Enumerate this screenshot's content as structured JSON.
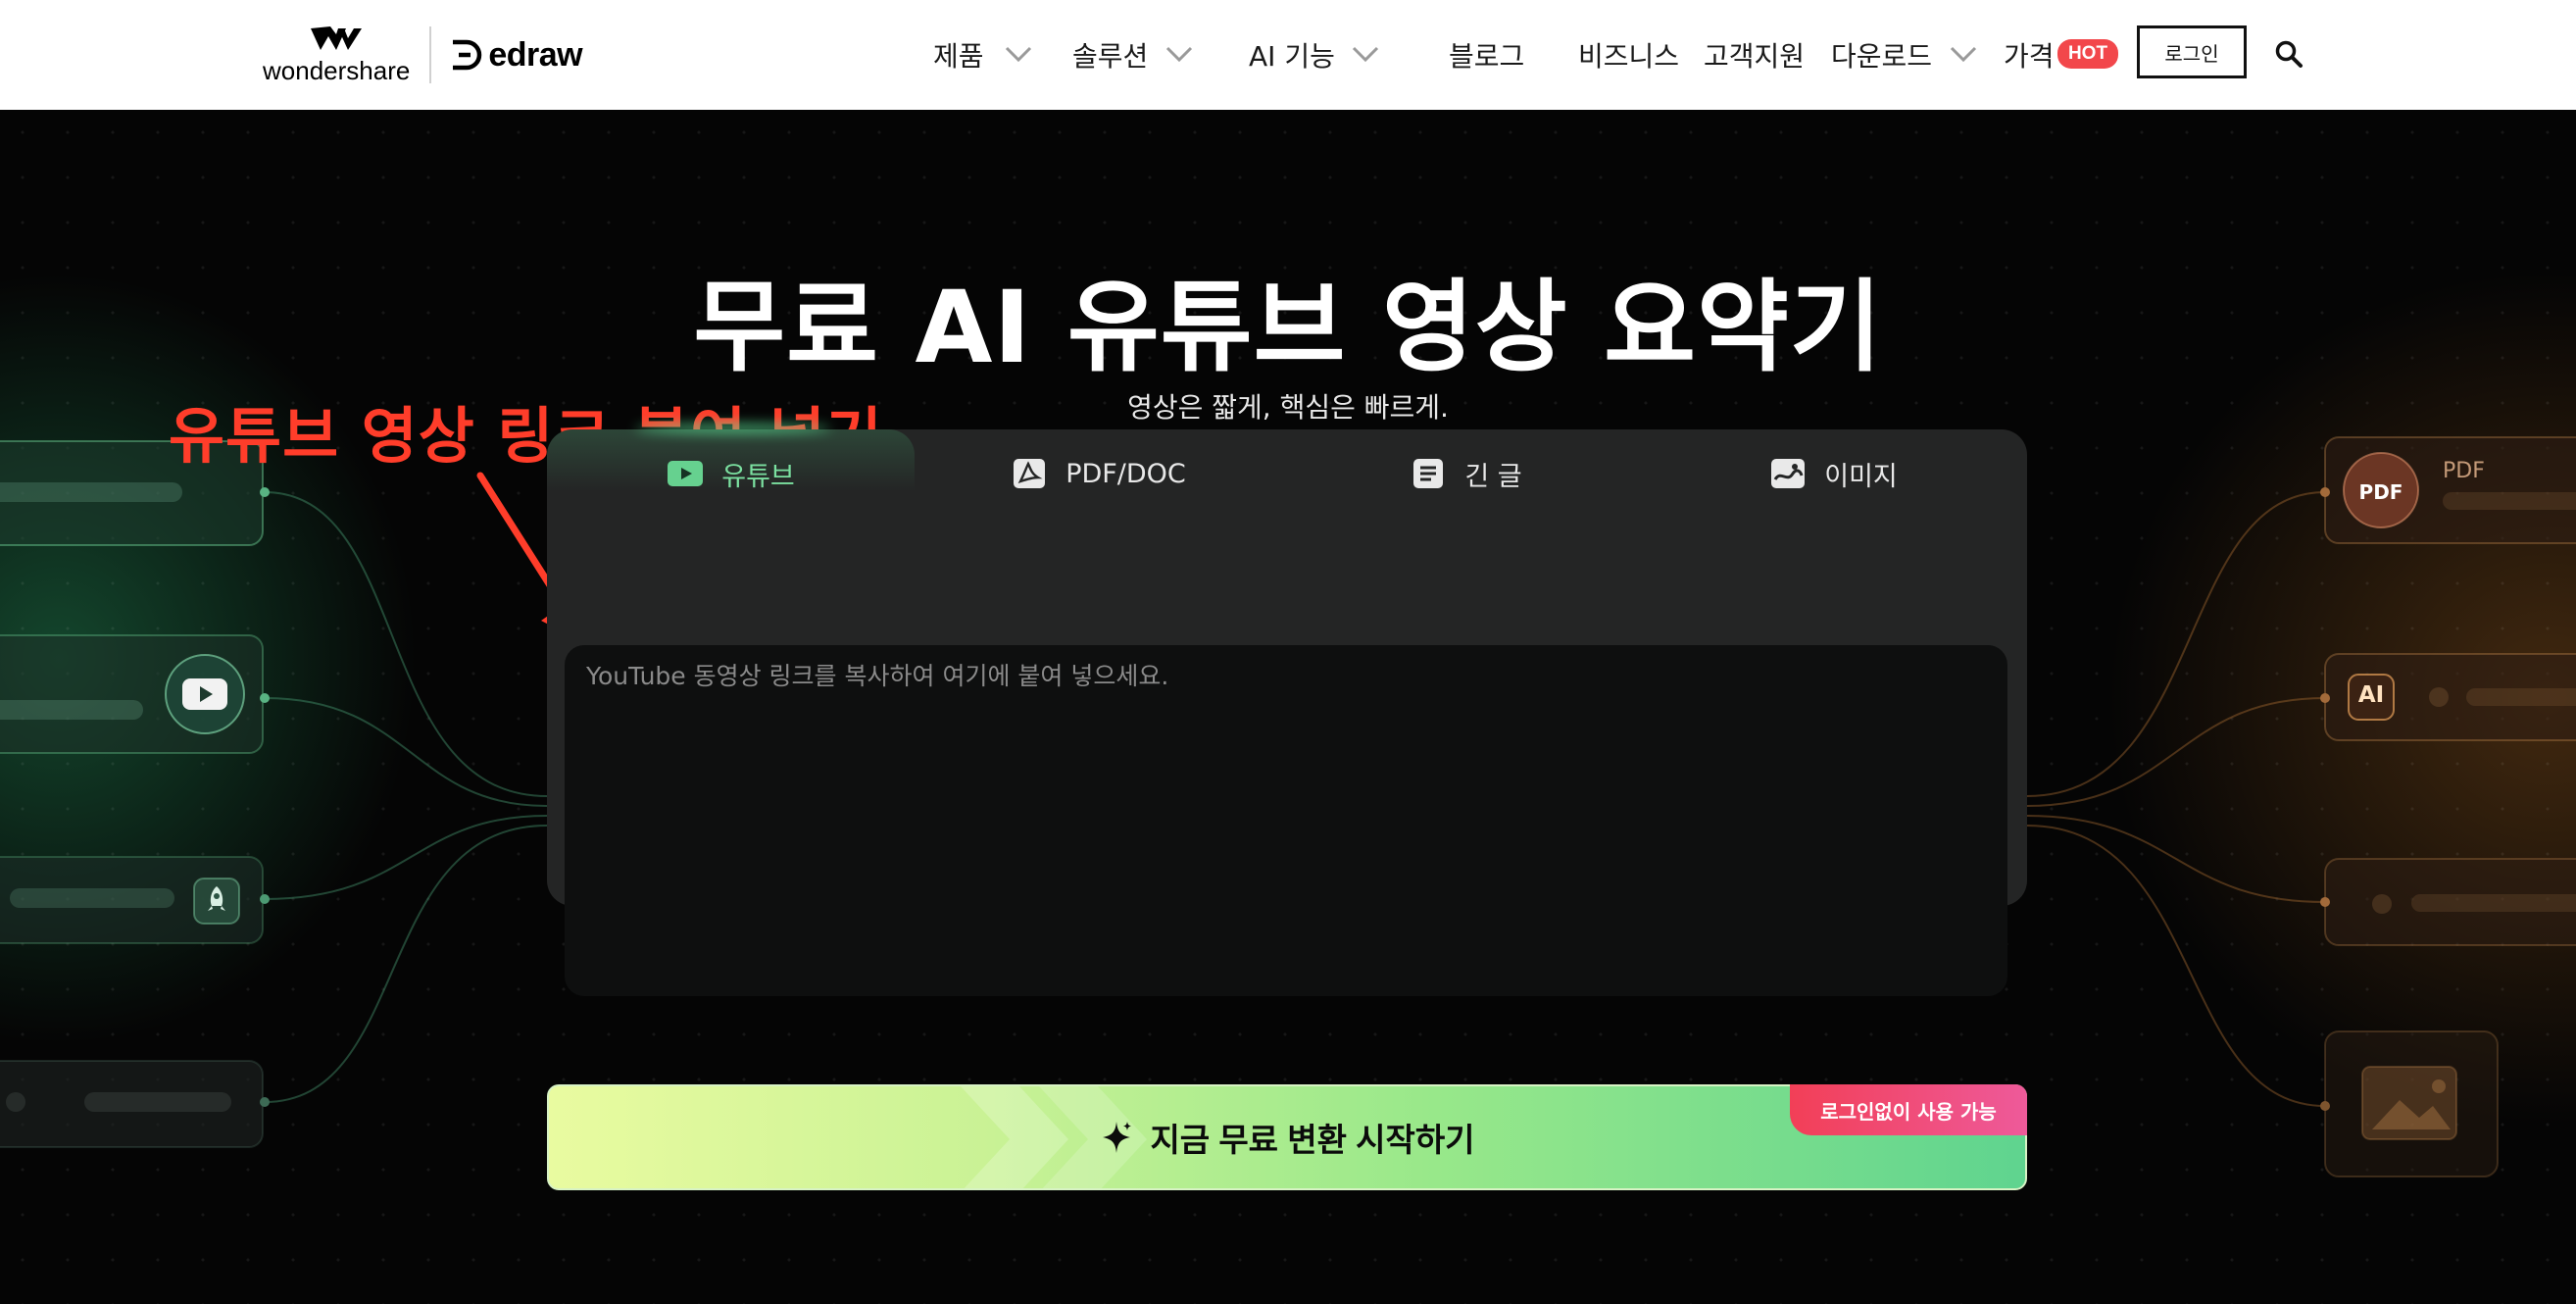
{
  "brand": {
    "wondershare": "wondershare",
    "edraw": "edraw"
  },
  "nav": {
    "items": [
      {
        "label": "제품"
      },
      {
        "label": "솔루션"
      },
      {
        "label": "AI 기능"
      },
      {
        "label": "블로그"
      },
      {
        "label": "비즈니스"
      },
      {
        "label": "고객지원"
      },
      {
        "label": "다운로드"
      },
      {
        "label": "가격"
      }
    ],
    "hot_badge": "HOT",
    "login": "로그인"
  },
  "hero": {
    "title": "무료 AI 유튜브 영상 요약기",
    "subtitle": "영상은 짧게, 핵심은 빠르게.",
    "annotation": "유튜브 영상 링크 붙여 넣기"
  },
  "tabs": [
    {
      "label": "유튜브"
    },
    {
      "label": "PDF/DOC"
    },
    {
      "label": "긴 글"
    },
    {
      "label": "이미지"
    }
  ],
  "input": {
    "placeholder": "YouTube 동영상 링크를 복사하여 여기에 붙여 넣으세요.",
    "value": ""
  },
  "cta": {
    "label": "지금 무료 변환 시작하기",
    "badge": "로그인없이 사용 가능"
  },
  "decor": {
    "pdf": "PDF",
    "ai": "AI",
    "pdf_label": "PDF"
  },
  "colors": {
    "accent_green": "#7be0a0",
    "annotation_red": "#ff3d2a",
    "hot_red": "#f2474b"
  }
}
